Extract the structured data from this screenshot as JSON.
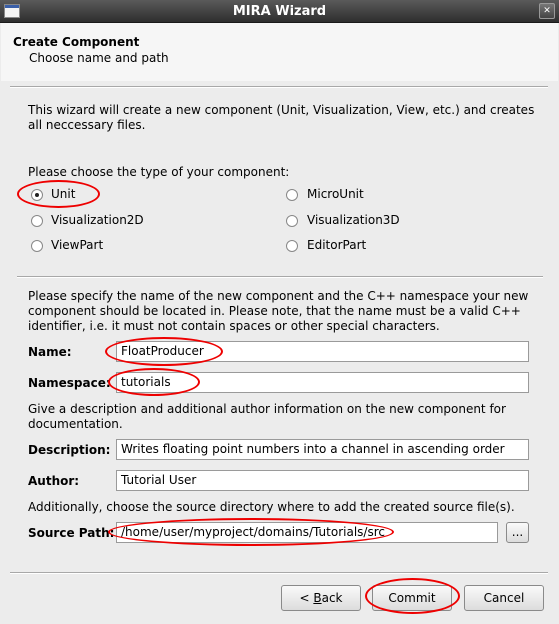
{
  "window": {
    "title": "MIRA Wizard",
    "close_glyph": "✕"
  },
  "header": {
    "title": "Create Component",
    "subtitle": "Choose name and path"
  },
  "intro": {
    "line1": "This wizard will create a new component (Unit, Visualization, View, etc.) and creates",
    "line2": "all neccessary files."
  },
  "type_prompt": "Please choose the type of your component:",
  "component_types": [
    {
      "label": "Unit",
      "selected": true
    },
    {
      "label": "MicroUnit",
      "selected": false
    },
    {
      "label": "Visualization2D",
      "selected": false
    },
    {
      "label": "Visualization3D",
      "selected": false
    },
    {
      "label": "ViewPart",
      "selected": false
    },
    {
      "label": "EditorPart",
      "selected": false
    }
  ],
  "name_info": {
    "line1": "Please specify the name of the new component and the C++ namespace your new",
    "line2": "component should be located in. Please note, that the name must be a valid C++",
    "line3": "identifier, i.e. it must not contain spaces or other special characters."
  },
  "fields": {
    "name": {
      "label": "Name:",
      "value": "FloatProducer"
    },
    "namespace": {
      "label": "Namespace:",
      "value": "tutorials"
    },
    "description": {
      "label": "Description:",
      "value": "Writes floating point numbers into a channel in ascending order"
    },
    "author": {
      "label": "Author:",
      "value": "Tutorial User"
    },
    "source_path": {
      "label": "Source Path:",
      "value": "/home/user/myproject/domains/Tutorials/src"
    }
  },
  "desc_info": {
    "line1": "Give a description and additional author information on the new component for",
    "line2": "documentation."
  },
  "source_info": "Additionally, choose the source directory where to add the created source file(s).",
  "browse_label": "...",
  "buttons": {
    "back_prefix": "< ",
    "back_mnemonic": "B",
    "back_rest": "ack",
    "commit": "Commit",
    "cancel": "Cancel"
  },
  "colors": {
    "highlight": "#e00000",
    "titlebar": "#3c3c3c"
  }
}
